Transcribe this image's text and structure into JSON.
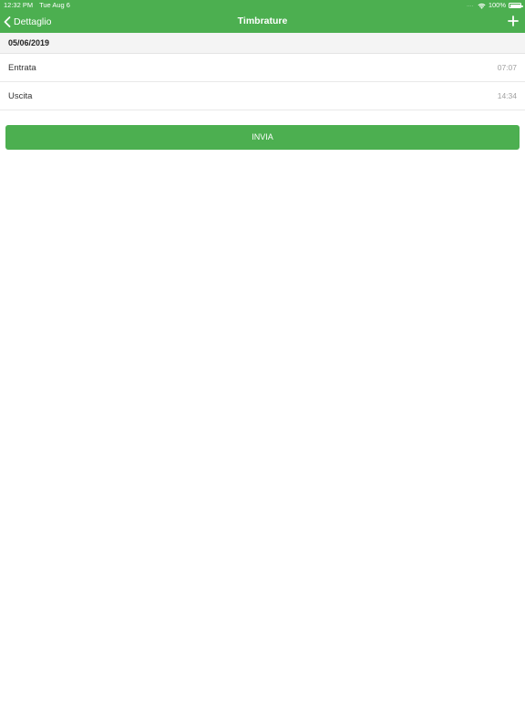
{
  "status_bar": {
    "time": "12:32 PM",
    "date": "Tue Aug 6",
    "signal": "....",
    "battery": "100%",
    "battery_level": 1.0
  },
  "nav": {
    "back_label": "Dettaglio",
    "title": "Timbrature",
    "back_icon": "chevron-left-icon",
    "add_icon": "plus-icon"
  },
  "section": {
    "date": "05/06/2019"
  },
  "entries": [
    {
      "label": "Entrata",
      "time": "07:07"
    },
    {
      "label": "Uscita",
      "time": "14:34"
    }
  ],
  "actions": {
    "send_label": "INVIA"
  },
  "colors": {
    "accent": "#4caf50",
    "secondary_text": "#a0a0a0"
  }
}
